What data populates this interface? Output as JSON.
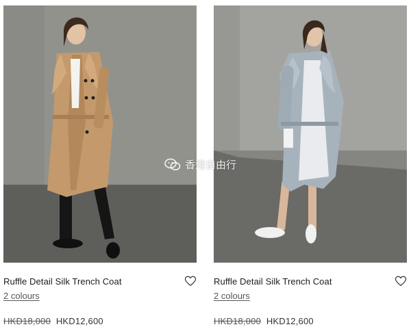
{
  "products": [
    {
      "name": "Ruffle Detail Silk Trench Coat",
      "colours": "2 colours",
      "original_price": "HKD18,000",
      "sale_price": "HKD12,600",
      "icon": "heart-outline-icon"
    },
    {
      "name": "Ruffle Detail Silk Trench Coat",
      "colours": "2 colours",
      "original_price": "HKD18,000",
      "sale_price": "HKD12,600",
      "icon": "heart-outline-icon"
    }
  ],
  "watermark": {
    "text": "香港自由行"
  },
  "colors": {
    "coat_left": "#c49a6c",
    "coat_right": "#a7b3bc",
    "background_wall": "#8f8f8b",
    "floor": "#5b5b58"
  }
}
